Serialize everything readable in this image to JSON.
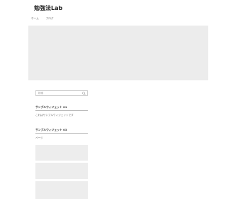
{
  "site": {
    "title": "勉強法Lab"
  },
  "nav": {
    "items": [
      "ホーム",
      "ブログ"
    ]
  },
  "search": {
    "placeholder": "検索"
  },
  "widgets": [
    {
      "title": "サンプルウィジェット 01",
      "text": "これはサンプルウィジェットです"
    },
    {
      "title": "サンプルウィジェット 03",
      "text": "ページ"
    }
  ]
}
